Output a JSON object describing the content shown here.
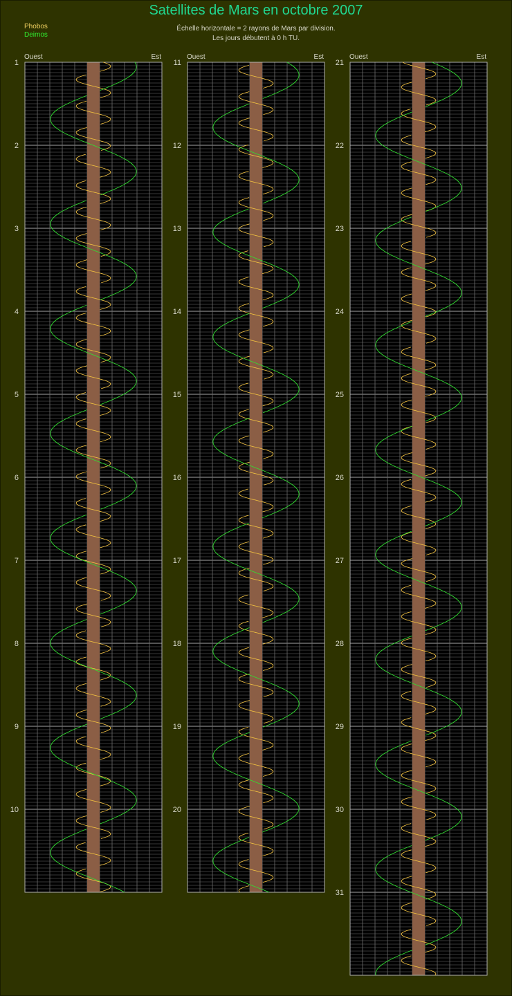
{
  "header": {
    "title": "Satellites de Mars en octobre 2007",
    "legend_phobos": "Phobos",
    "legend_deimos": "Deimos",
    "subtitle_line1": "Échelle horizontale = 2 rayons de Mars par division.",
    "subtitle_line2": "Les jours débutent à 0 h TU."
  },
  "colors": {
    "background": "#2e3300",
    "panel": "#000000",
    "grid": "#6e6e6e",
    "mars": "#8b5e45",
    "phobos": "#f0c040",
    "deimos": "#30e030",
    "title": "#20d890",
    "text": "#d8d8c8"
  },
  "chart_data": {
    "type": "line",
    "title": "Satellites de Mars en octobre 2007",
    "month_days": 31,
    "columns": [
      {
        "first_day": 1,
        "last_day": 10,
        "xlabel_left": "Ouest",
        "xlabel_right": "Est"
      },
      {
        "first_day": 11,
        "last_day": 20,
        "xlabel_left": "Ouest",
        "xlabel_right": "Est"
      },
      {
        "first_day": 21,
        "last_day": 31,
        "xlabel_left": "Ouest",
        "xlabel_right": "Est"
      }
    ],
    "x_unit": "rayons de Mars",
    "x_per_division": 2,
    "xlim": [
      -11,
      11
    ],
    "mars_radius": 1,
    "series": [
      {
        "name": "Phobos",
        "color": "#f0c040",
        "period_days": 0.3189,
        "amplitude": 2.76,
        "inclination_ratio": 0.3
      },
      {
        "name": "Deimos",
        "color": "#30e030",
        "period_days": 1.2624,
        "amplitude": 6.9,
        "inclination_ratio": 0.15
      }
    ]
  }
}
